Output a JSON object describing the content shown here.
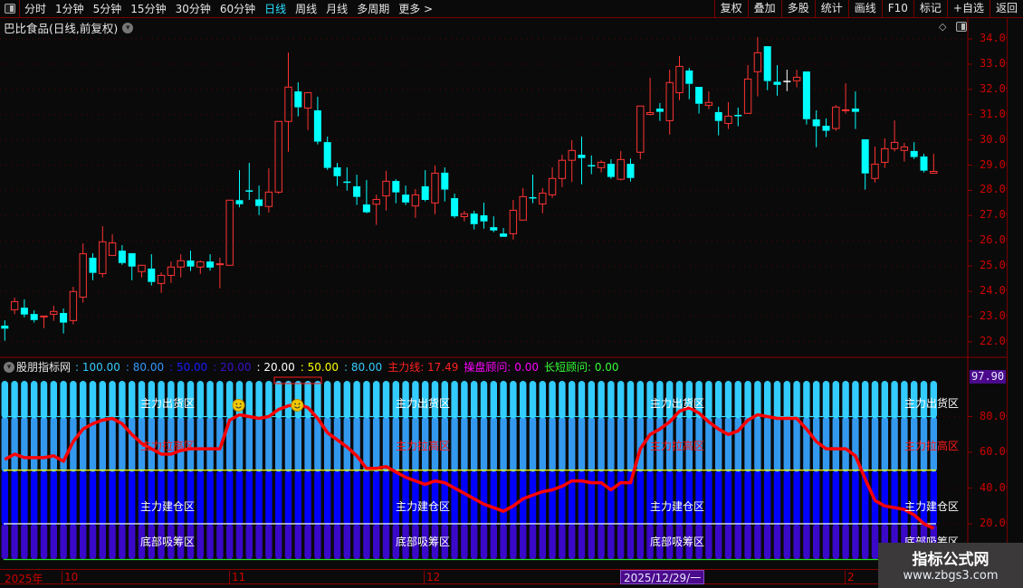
{
  "toolbar": {
    "periods": [
      "分时",
      "1分钟",
      "5分钟",
      "15分钟",
      "30分钟",
      "60分钟",
      "日线",
      "周线",
      "月线",
      "多周期",
      "更多 >"
    ],
    "active_period": "日线",
    "buttons": [
      "复权",
      "叠加",
      "多股",
      "统计",
      "画线",
      "F10",
      "标记",
      "+自选",
      "返回"
    ]
  },
  "header": {
    "title": "巴比食品(日线,前复权)"
  },
  "indicator": {
    "name": "股朋指标网",
    "params": [
      {
        "text": ": 100.00",
        "color": "#33ccff"
      },
      {
        "text": ": 80.00",
        "color": "#3399ff"
      },
      {
        "text": ": 50.00",
        "color": "#1a1aff"
      },
      {
        "text": ": 20.00",
        "color": "#3a10c8"
      },
      {
        "text": ": 20.00",
        "color": "#ffffff"
      },
      {
        "text": ": 50.00",
        "color": "#ffff00"
      },
      {
        "text": ": 80.00",
        "color": "#33ccff"
      },
      {
        "text": "主力线: 17.49",
        "color": "#ff2020"
      },
      {
        "text": "操盘顾问: 0.00",
        "color": "#ff00ff"
      },
      {
        "text": "长短顾问: 0.00",
        "color": "#33ff33"
      }
    ],
    "max_label": "97.90",
    "axis_ticks": [
      "80.00",
      "60.00",
      "40.00",
      "20.00"
    ],
    "zones": [
      {
        "label": "主力出货区",
        "color": "#ffffff"
      },
      {
        "label": "主力拉高区",
        "color": "#ff1a1a"
      },
      {
        "label": "主力建仓区",
        "color": "#ffffff"
      },
      {
        "label": "底部吸筹区",
        "color": "#ffffff"
      }
    ],
    "segment_colors": [
      "#3a08c8",
      "#0000ff",
      "#3399ee",
      "#33ccff"
    ],
    "level_lines": [
      {
        "v": 80,
        "color": "#33ddff"
      },
      {
        "v": 50,
        "color": "#ffff00"
      },
      {
        "v": 20,
        "color": "#ffffff"
      },
      {
        "v": 0,
        "color": "#22dd22"
      }
    ],
    "main_line": [
      56,
      59,
      57,
      57,
      57,
      58,
      55,
      66,
      73,
      76,
      78,
      79,
      76,
      70,
      65,
      62,
      59,
      59,
      61,
      62,
      62,
      62,
      62,
      78,
      81,
      80,
      79,
      80,
      84,
      86,
      87,
      85,
      79,
      71,
      67,
      63,
      58,
      51,
      51,
      52,
      49,
      46,
      44,
      42,
      44,
      43,
      40,
      37,
      34,
      31,
      29,
      27,
      30,
      34,
      36,
      38,
      39,
      41,
      44,
      44,
      43,
      43,
      39,
      43,
      43,
      62,
      70,
      73,
      77,
      83,
      85,
      82,
      77,
      73,
      70,
      72,
      78,
      81,
      80,
      79,
      79,
      79,
      73,
      66,
      62,
      62,
      62,
      58,
      45,
      33,
      30,
      29,
      28,
      25,
      20,
      17.49
    ],
    "smiley_candles": [
      24,
      30
    ]
  },
  "chart_data": {
    "type": "candlestick",
    "ylim": [
      21.5,
      34.3
    ],
    "y_ticks": [
      "34.00",
      "33.00",
      "32.00",
      "31.00",
      "30.00",
      "29.00",
      "28.00",
      "27.00",
      "26.00",
      "25.00",
      "24.00",
      "23.00",
      "22.00"
    ],
    "up_color": "#ff3333",
    "down_color": "#00ffff",
    "candles_ohlc": [
      [
        22.64,
        22.52,
        22.85,
        22.04
      ],
      [
        23.27,
        23.59,
        23.75,
        23.09
      ],
      [
        23.35,
        23.08,
        23.68,
        22.97
      ],
      [
        23.1,
        22.86,
        23.25,
        22.76
      ],
      [
        23.0,
        23.02,
        23.02,
        22.54
      ],
      [
        23.09,
        23.2,
        23.43,
        22.83
      ],
      [
        23.14,
        22.76,
        23.32,
        22.33
      ],
      [
        22.84,
        23.99,
        24.18,
        22.69
      ],
      [
        23.77,
        25.49,
        25.9,
        23.55
      ],
      [
        25.33,
        24.73,
        25.51,
        24.44
      ],
      [
        24.7,
        25.96,
        26.58,
        24.55
      ],
      [
        25.42,
        25.92,
        26.26,
        25.42
      ],
      [
        25.61,
        25.12,
        25.83,
        25.05
      ],
      [
        25.51,
        24.98,
        25.51,
        24.44
      ],
      [
        24.78,
        25.03,
        25.03,
        24.55
      ],
      [
        24.9,
        24.37,
        25.47,
        24.23
      ],
      [
        24.31,
        24.63,
        24.75,
        23.94
      ],
      [
        24.63,
        24.96,
        25.18,
        24.33
      ],
      [
        24.96,
        25.21,
        25.47,
        24.55
      ],
      [
        25.22,
        24.98,
        25.61,
        24.8
      ],
      [
        24.96,
        25.17,
        25.22,
        24.69
      ],
      [
        25.18,
        24.94,
        25.47,
        24.82
      ],
      [
        25.08,
        25.09,
        25.33,
        24.12
      ],
      [
        25.03,
        27.61,
        27.61,
        25.03
      ],
      [
        27.61,
        27.45,
        28.8,
        27.33
      ],
      [
        28.0,
        27.99,
        29.09,
        27.62
      ],
      [
        27.64,
        27.38,
        28.19,
        27.02
      ],
      [
        27.36,
        27.93,
        28.87,
        27.12
      ],
      [
        27.93,
        30.73,
        30.73,
        27.86
      ],
      [
        30.73,
        32.09,
        33.46,
        29.53
      ],
      [
        31.92,
        31.29,
        32.28,
        30.93
      ],
      [
        31.26,
        31.87,
        31.87,
        30.39
      ],
      [
        31.17,
        29.93,
        31.71,
        29.82
      ],
      [
        29.91,
        28.89,
        30.13,
        28.81
      ],
      [
        28.91,
        28.56,
        29.09,
        28.17
      ],
      [
        28.35,
        28.34,
        28.91,
        27.99
      ],
      [
        28.16,
        27.74,
        28.62,
        27.42
      ],
      [
        27.44,
        27.13,
        28.41,
        27.09
      ],
      [
        27.45,
        27.64,
        27.83,
        26.63
      ],
      [
        27.78,
        28.36,
        28.77,
        27.2
      ],
      [
        28.37,
        27.92,
        28.44,
        27.49
      ],
      [
        27.83,
        27.52,
        28.19,
        27.42
      ],
      [
        27.38,
        27.82,
        28.05,
        26.91
      ],
      [
        28.16,
        27.62,
        28.8,
        27.56
      ],
      [
        27.5,
        28.68,
        28.98,
        27.06
      ],
      [
        28.7,
        28.03,
        28.91,
        27.56
      ],
      [
        27.69,
        26.97,
        27.87,
        26.9
      ],
      [
        26.96,
        27.07,
        27.19,
        26.77
      ],
      [
        27.08,
        26.66,
        27.19,
        26.45
      ],
      [
        27.01,
        26.77,
        27.51,
        26.48
      ],
      [
        26.54,
        26.41,
        26.97,
        26.34
      ],
      [
        26.29,
        26.16,
        26.51,
        26.16
      ],
      [
        26.28,
        27.21,
        27.62,
        26.05
      ],
      [
        26.82,
        27.75,
        28.09,
        26.82
      ],
      [
        27.73,
        27.72,
        28.62,
        27.49
      ],
      [
        27.46,
        27.89,
        28.09,
        27.09
      ],
      [
        27.82,
        28.47,
        28.91,
        27.7
      ],
      [
        28.47,
        29.19,
        29.41,
        28.13
      ],
      [
        29.19,
        29.58,
        29.99,
        28.33
      ],
      [
        29.41,
        29.28,
        30.13,
        28.24
      ],
      [
        29.0,
        28.99,
        29.38,
        28.64
      ],
      [
        28.9,
        29.11,
        29.19,
        28.71
      ],
      [
        29.05,
        28.53,
        29.23,
        28.46
      ],
      [
        28.44,
        29.22,
        29.56,
        28.39
      ],
      [
        29.05,
        28.49,
        29.26,
        28.35
      ],
      [
        29.51,
        31.34,
        31.34,
        29.24
      ],
      [
        31.01,
        31.08,
        32.46,
        30.97
      ],
      [
        31.24,
        31.11,
        31.46,
        30.75
      ],
      [
        30.76,
        32.27,
        32.78,
        30.21
      ],
      [
        31.87,
        32.91,
        33.32,
        31.57
      ],
      [
        32.75,
        32.22,
        32.85,
        31.61
      ],
      [
        32.1,
        31.43,
        32.1,
        31.04
      ],
      [
        31.37,
        31.48,
        31.92,
        31.22
      ],
      [
        31.1,
        30.75,
        31.31,
        30.18
      ],
      [
        30.65,
        30.94,
        31.49,
        30.43
      ],
      [
        30.99,
        30.98,
        31.28,
        30.54
      ],
      [
        31.05,
        32.41,
        32.96,
        31.05
      ],
      [
        32.7,
        33.45,
        34.07,
        31.72
      ],
      [
        33.71,
        32.33,
        33.71,
        31.97
      ],
      [
        32.3,
        32.18,
        32.96,
        31.75
      ],
      [
        32.34,
        32.34,
        32.78,
        31.93
      ],
      [
        32.34,
        32.48,
        32.78,
        32.08
      ],
      [
        32.71,
        30.82,
        32.71,
        30.61
      ],
      [
        30.81,
        30.54,
        31.17,
        29.71
      ],
      [
        30.56,
        30.36,
        30.85,
        30.11
      ],
      [
        30.45,
        31.3,
        31.38,
        30.36
      ],
      [
        31.18,
        31.19,
        32.24,
        31.04
      ],
      [
        31.24,
        31.11,
        31.92,
        30.43
      ],
      [
        30.02,
        28.67,
        30.02,
        28.03
      ],
      [
        28.47,
        29.04,
        29.73,
        28.31
      ],
      [
        29.11,
        29.65,
        30.06,
        28.89
      ],
      [
        29.65,
        29.9,
        30.77,
        29.54
      ],
      [
        29.58,
        29.72,
        29.88,
        29.14
      ],
      [
        29.56,
        29.32,
        29.91,
        29.24
      ],
      [
        29.34,
        28.78,
        29.45,
        28.71
      ],
      [
        28.68,
        28.75,
        29.45,
        28.68
      ]
    ]
  },
  "time_axis": {
    "labels": [
      "2025年",
      "10",
      "11",
      "12",
      "2"
    ],
    "selected": "2025/12/29/一"
  },
  "watermark": {
    "title": "指标公式网",
    "url": "www.zbgs3.com"
  }
}
